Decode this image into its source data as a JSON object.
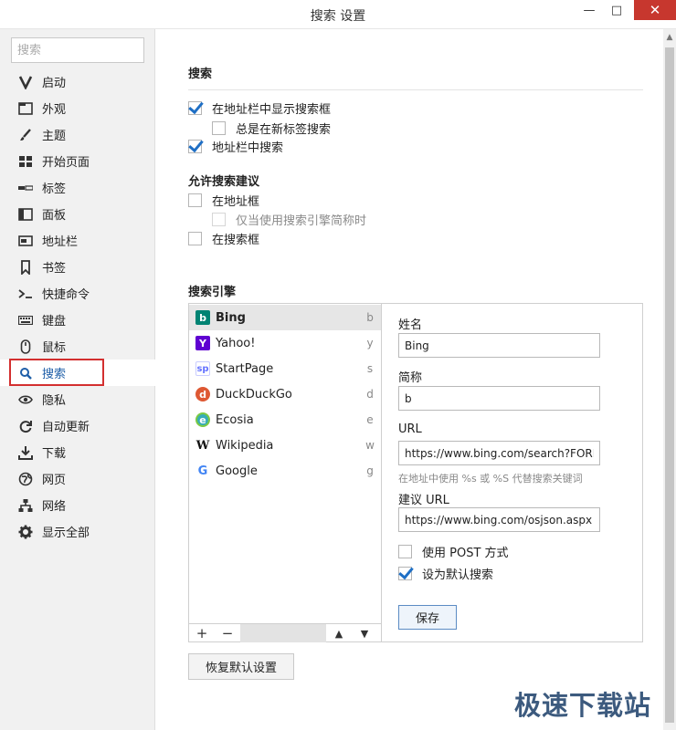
{
  "window": {
    "title": "搜索 设置",
    "minimize_label": "—",
    "maximize_label": "□",
    "close_label": "✕"
  },
  "sidebar": {
    "search_placeholder": "搜索",
    "items": [
      {
        "label": "启动",
        "icon": "vivaldi-icon"
      },
      {
        "label": "外观",
        "icon": "window-icon"
      },
      {
        "label": "主题",
        "icon": "brush-icon"
      },
      {
        "label": "开始页面",
        "icon": "grid-icon"
      },
      {
        "label": "标签",
        "icon": "tabs-icon"
      },
      {
        "label": "面板",
        "icon": "panel-icon"
      },
      {
        "label": "地址栏",
        "icon": "address-bar-icon"
      },
      {
        "label": "书签",
        "icon": "bookmark-icon"
      },
      {
        "label": "快捷命令",
        "icon": "command-icon"
      },
      {
        "label": "键盘",
        "icon": "keyboard-icon"
      },
      {
        "label": "鼠标",
        "icon": "mouse-icon"
      },
      {
        "label": "搜索",
        "icon": "search-icon",
        "active": true
      },
      {
        "label": "隐私",
        "icon": "eye-icon"
      },
      {
        "label": "自动更新",
        "icon": "refresh-icon"
      },
      {
        "label": "下载",
        "icon": "download-icon"
      },
      {
        "label": "网页",
        "icon": "globe-icon"
      },
      {
        "label": "网络",
        "icon": "network-icon"
      },
      {
        "label": "显示全部",
        "icon": "gear-icon"
      }
    ]
  },
  "search_section": {
    "heading": "搜索",
    "show_search_box": {
      "label": "在地址栏中显示搜索框",
      "checked": true
    },
    "always_new_tab": {
      "label": "总是在新标签搜索",
      "checked": false
    },
    "search_in_address": {
      "label": "地址栏中搜索",
      "checked": true
    }
  },
  "suggestions_section": {
    "heading": "允许搜索建议",
    "in_address": {
      "label": "在地址框",
      "checked": false
    },
    "only_nickname": {
      "label": "仅当使用搜索引擎简称时",
      "checked": false,
      "disabled": true
    },
    "in_search_box": {
      "label": "在搜索框",
      "checked": false
    }
  },
  "engines_section": {
    "heading": "搜索引擎",
    "engines": [
      {
        "name": "Bing",
        "key": "b",
        "logo": "b",
        "color": "#008373",
        "selected": true
      },
      {
        "name": "Yahoo!",
        "key": "y",
        "logo": "Y",
        "color": "#5f01d1"
      },
      {
        "name": "StartPage",
        "key": "s",
        "logo": "sp",
        "color": "#6573ff"
      },
      {
        "name": "DuckDuckGo",
        "key": "d",
        "logo": "d",
        "color": "#de5833"
      },
      {
        "name": "Ecosia",
        "key": "e",
        "logo": "e",
        "color": "#36acb8"
      },
      {
        "name": "Wikipedia",
        "key": "w",
        "logo": "W",
        "color": "#ffffff"
      },
      {
        "name": "Google",
        "key": "g",
        "logo": "G",
        "color": "#ffffff"
      }
    ],
    "toolbar": {
      "add": "+",
      "remove": "−",
      "up": "▲",
      "down": "▼"
    },
    "form": {
      "name_label": "姓名",
      "name_value": "Bing",
      "nickname_label": "简称",
      "nickname_value": "b",
      "url_label": "URL",
      "url_value": "https://www.bing.com/search?FORM",
      "url_hint": "在地址中使用 %s 或 %S 代替搜索关键词",
      "suggest_label": "建议 URL",
      "suggest_value": "https://www.bing.com/osjson.aspx",
      "use_post": {
        "label": "使用 POST 方式",
        "checked": false
      },
      "set_default": {
        "label": "设为默认搜索",
        "checked": true
      },
      "save_label": "保存"
    }
  },
  "reset_label": "恢复默认设置",
  "watermark": "极速下载站"
}
